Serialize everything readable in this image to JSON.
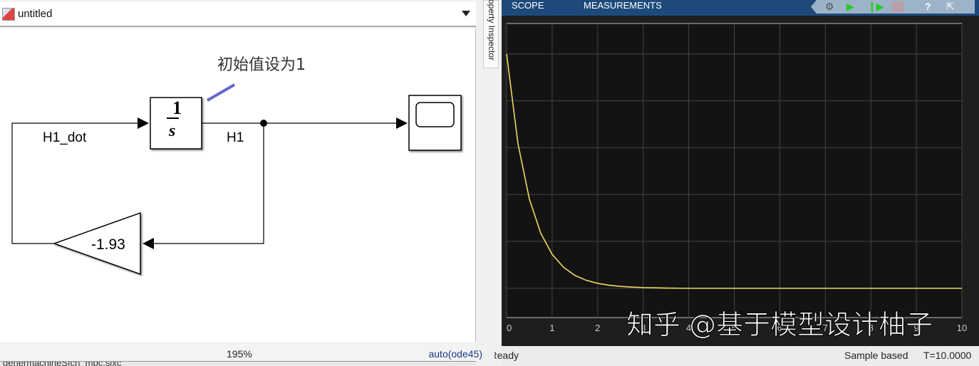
{
  "model": {
    "title": "untitled",
    "zoom": "195%",
    "solver": "auto(ode45)",
    "bottom_file": "genermachineSfcn_mpc.slxc"
  },
  "diagram": {
    "annotation": "初始值设为1",
    "integrator_num": "1",
    "integrator_den": "s",
    "gain_value": "-1.93",
    "signal_in": "H1_dot",
    "signal_out": "H1"
  },
  "property_inspector": "Property Inspector",
  "scope": {
    "tabs": [
      "SCOPE",
      "MEASUREMENTS"
    ],
    "tools": [
      "settings-icon",
      "run-icon",
      "step-forward-icon",
      "stop-icon",
      "help-icon",
      "undock-icon"
    ],
    "status_left": "Ready",
    "status_mode": "Sample based",
    "status_time": "T=10.0000",
    "watermark": "知乎 @基于模型设计柚子",
    "line_color": "#f0d860"
  },
  "chart_data": {
    "type": "line",
    "title": "",
    "xlabel": "",
    "ylabel": "",
    "xlim": [
      0,
      10
    ],
    "ylim": [
      -0.125,
      1.13
    ],
    "xticks": [
      "0",
      "1",
      "2",
      "3",
      "4",
      "5",
      "6",
      "7",
      "8",
      "9",
      "10"
    ],
    "ygrid": [
      0,
      0.2,
      0.4,
      0.6,
      0.8,
      1.0
    ],
    "grid": true,
    "series": [
      {
        "name": "H1",
        "x": [
          0,
          0.25,
          0.5,
          0.75,
          1,
          1.25,
          1.5,
          1.75,
          2,
          2.25,
          2.5,
          2.75,
          3,
          3.25,
          3.5,
          4,
          10
        ],
        "y": [
          1,
          0.617,
          0.381,
          0.235,
          0.145,
          0.09,
          0.055,
          0.034,
          0.021,
          0.013,
          0.008,
          0.005,
          0.003,
          0.002,
          0.001,
          0,
          0
        ]
      }
    ]
  }
}
